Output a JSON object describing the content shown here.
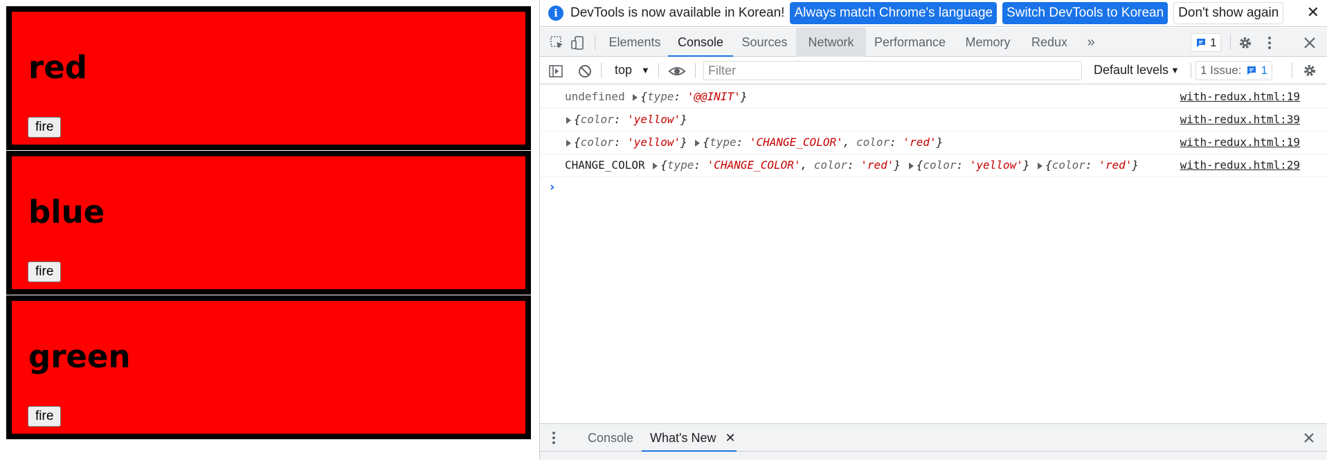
{
  "page": {
    "cards": [
      {
        "title": "red",
        "button": "fire"
      },
      {
        "title": "blue",
        "button": "fire"
      },
      {
        "title": "green",
        "button": "fire"
      }
    ]
  },
  "infobar": {
    "message": "DevTools is now available in Korean!",
    "btn_match": "Always match Chrome's language",
    "btn_switch": "Switch DevTools to Korean",
    "btn_dismiss": "Don't show again"
  },
  "tabs": [
    "Elements",
    "Console",
    "Sources",
    "Network",
    "Performance",
    "Memory",
    "Redux"
  ],
  "selected_tab": "Console",
  "issues_count": "1",
  "toolbar": {
    "context": "top",
    "filter_placeholder": "Filter",
    "levels": "Default levels",
    "issues_label": "1 Issue:",
    "issues_count": "1"
  },
  "console_logs": [
    {
      "prefix": "undefined",
      "parts": [
        {
          "obj": "{type: '@@INIT'}"
        }
      ],
      "source": "with-redux.html:19"
    },
    {
      "prefix": "",
      "parts": [
        {
          "obj": "{color: 'yellow'}"
        }
      ],
      "source": "with-redux.html:39"
    },
    {
      "prefix": "",
      "parts": [
        {
          "obj": "{color: 'yellow'}"
        },
        {
          "obj": "{type: 'CHANGE_COLOR', color: 'red'}"
        }
      ],
      "source": "with-redux.html:19"
    },
    {
      "prefix": "CHANGE_COLOR",
      "parts": [
        {
          "obj": "{type: 'CHANGE_COLOR', color: 'red'}"
        },
        {
          "obj": "{color: 'yellow'}"
        },
        {
          "obj": "{color: 'red'}"
        }
      ],
      "source": "with-redux.html:29"
    }
  ],
  "drawer": {
    "tabs": [
      "Console",
      "What's New"
    ],
    "selected": "What's New"
  },
  "colors": {
    "card_bg": "#ff0000",
    "card_border": "#000000",
    "accent": "#1a73e8"
  }
}
